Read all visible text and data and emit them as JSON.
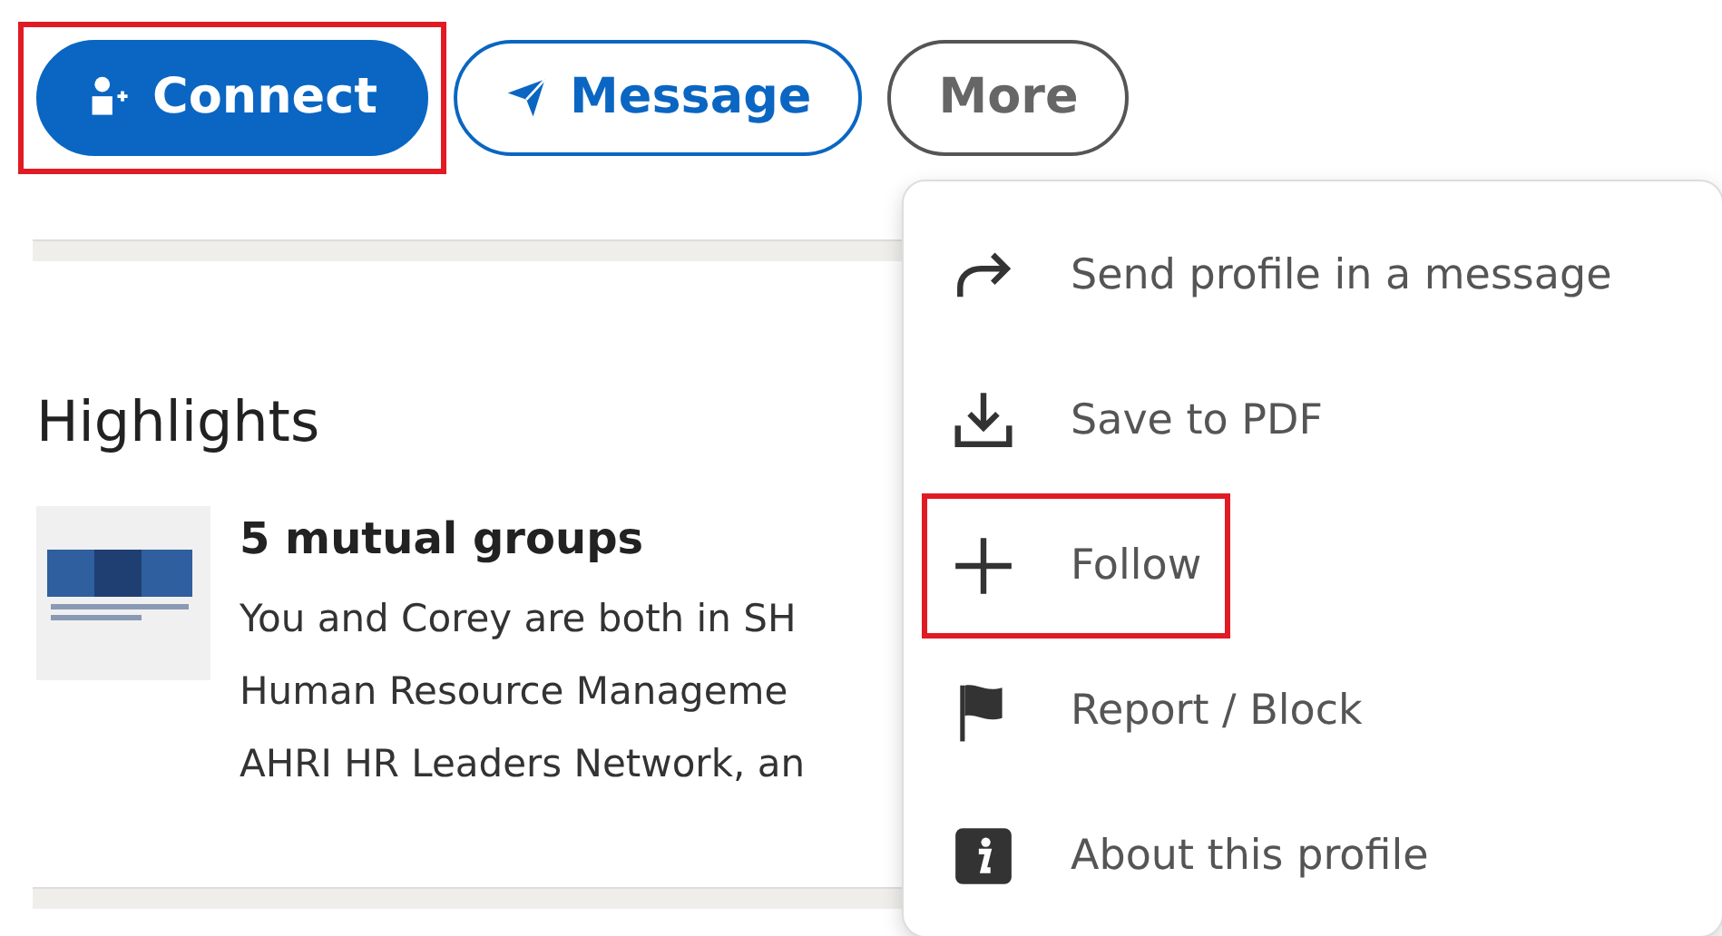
{
  "actions": [
    {
      "kind": "primary",
      "label": "Connect",
      "highlighted": true
    },
    {
      "kind": "outline",
      "label": "Message",
      "highlighted": false
    },
    {
      "kind": "secondary",
      "label": "More",
      "highlighted": false
    }
  ],
  "highlights": {
    "heading": "Highlights",
    "item": {
      "kind": "picture",
      "title": "5 mutual groups",
      "lines": [
        "You and Corey are both in SH",
        "Human Resource Manageme",
        "AHRI HR Leaders Network, an"
      ]
    }
  },
  "menu": {
    "items": [
      {
        "label": "Send profile in a message",
        "highlighted": false
      },
      {
        "label": "Save to PDF",
        "highlighted": false
      },
      {
        "label": "Follow",
        "highlighted": true
      },
      {
        "label": "Report / Block",
        "highlighted": false
      },
      {
        "label": "About this profile",
        "highlighted": false
      }
    ]
  }
}
